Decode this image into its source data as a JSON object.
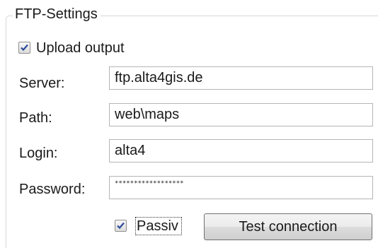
{
  "group": {
    "title": "FTP-Settings"
  },
  "upload": {
    "label": "Upload output",
    "checked": true
  },
  "fields": {
    "server": {
      "label": "Server:",
      "value": "ftp.alta4gis.de"
    },
    "path": {
      "label": "Path:",
      "value": "web\\maps"
    },
    "login": {
      "label": "Login:",
      "value": "alta4"
    },
    "password": {
      "label": "Password:",
      "value": "******************"
    }
  },
  "passive": {
    "label": "Passiv",
    "checked": true
  },
  "buttons": {
    "test_connection": "Test connection"
  }
}
